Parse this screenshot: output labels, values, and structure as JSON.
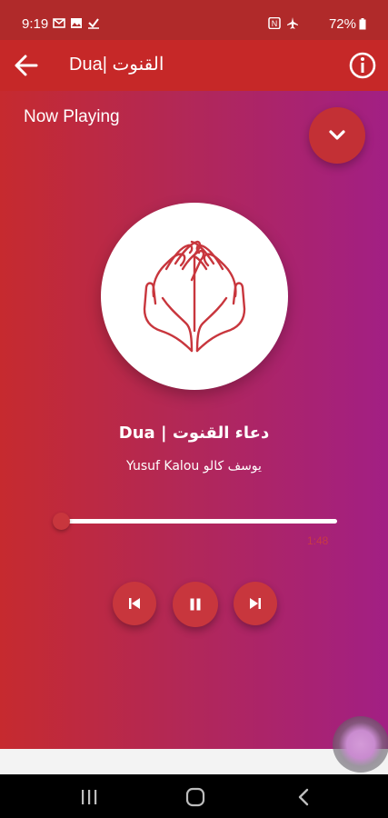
{
  "status_bar": {
    "time": "9:19",
    "battery": "72%",
    "left_icons": [
      "gmail-icon",
      "gallery-icon",
      "check-icon"
    ],
    "right_icons": [
      "nfc-icon",
      "airplane-icon"
    ]
  },
  "app_bar": {
    "title": "Dua| القنوت",
    "back_icon": "arrow-left-icon",
    "info_icon": "info-icon"
  },
  "player": {
    "now_playing_label": "Now Playing",
    "track_title": "Dua | دعاء القنوت",
    "artist": "Yusuf Kalou يوسف كالو",
    "duration": "1:48",
    "progress": 0.0,
    "is_playing": true,
    "artwork_icon": "praying-hands-icon"
  },
  "controls": {
    "prev_icon": "skip-previous-icon",
    "play_pause_icon": "pause-icon",
    "next_icon": "skip-next-icon",
    "collapse_icon": "chevron-down-icon"
  },
  "nav_bar": {
    "recents_icon": "recents-icon",
    "home_icon": "home-icon",
    "back_icon": "back-icon"
  },
  "colors": {
    "status_bar": "#b02a2a",
    "app_bar": "#c62828",
    "gradient_start": "#c62a2f",
    "gradient_end": "#a21f84",
    "accent_button": "#c8363d"
  }
}
